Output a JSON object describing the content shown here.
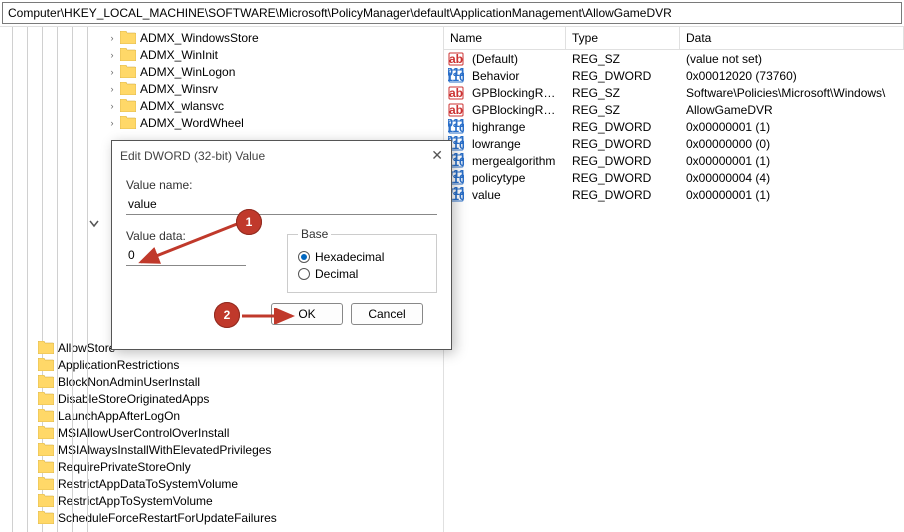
{
  "path": "Computer\\HKEY_LOCAL_MACHINE\\SOFTWARE\\Microsoft\\PolicyManager\\default\\ApplicationManagement\\AllowGameDVR",
  "tree": {
    "top": [
      "ADMX_WindowsStore",
      "ADMX_WinInit",
      "ADMX_WinLogon",
      "ADMX_Winsrv",
      "ADMX_wlansvc",
      "ADMX_WordWheel"
    ],
    "bottom": [
      "AllowStore",
      "ApplicationRestrictions",
      "BlockNonAdminUserInstall",
      "DisableStoreOriginatedApps",
      "LaunchAppAfterLogOn",
      "MSIAllowUserControlOverInstall",
      "MSIAlwaysInstallWithElevatedPrivileges",
      "RequirePrivateStoreOnly",
      "RestrictAppDataToSystemVolume",
      "RestrictAppToSystemVolume",
      "ScheduleForceRestartForUpdateFailures"
    ]
  },
  "list": {
    "headers": {
      "name": "Name",
      "type": "Type",
      "data": "Data"
    },
    "rows": [
      {
        "icon": "sz",
        "name": "(Default)",
        "type": "REG_SZ",
        "data": "(value not set)"
      },
      {
        "icon": "dw",
        "name": "Behavior",
        "type": "REG_DWORD",
        "data": "0x00012020 (73760)"
      },
      {
        "icon": "sz",
        "name": "GPBlockingReg...",
        "type": "REG_SZ",
        "data": "Software\\Policies\\Microsoft\\Windows\\"
      },
      {
        "icon": "sz",
        "name": "GPBlockingReg...",
        "type": "REG_SZ",
        "data": "AllowGameDVR"
      },
      {
        "icon": "dw",
        "name": "highrange",
        "type": "REG_DWORD",
        "data": "0x00000001 (1)"
      },
      {
        "icon": "dw",
        "name": "lowrange",
        "type": "REG_DWORD",
        "data": "0x00000000 (0)"
      },
      {
        "icon": "dw",
        "name": "mergealgorithm",
        "type": "REG_DWORD",
        "data": "0x00000001 (1)"
      },
      {
        "icon": "dw",
        "name": "policytype",
        "type": "REG_DWORD",
        "data": "0x00000004 (4)"
      },
      {
        "icon": "dw",
        "name": "value",
        "type": "REG_DWORD",
        "data": "0x00000001 (1)"
      }
    ]
  },
  "dialog": {
    "title": "Edit DWORD (32-bit) Value",
    "value_name_label": "Value name:",
    "value_name": "value",
    "value_data_label": "Value data:",
    "value_data": "0",
    "base_label": "Base",
    "hex": "Hexadecimal",
    "dec": "Decimal",
    "ok": "OK",
    "cancel": "Cancel"
  },
  "annotations": {
    "one": "1",
    "two": "2"
  }
}
